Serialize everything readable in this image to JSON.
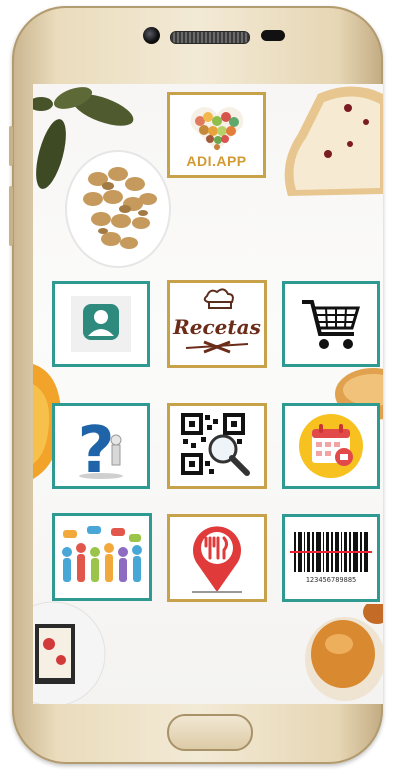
{
  "app": {
    "logo_text": "ADI.APP"
  },
  "tiles": [
    {
      "icon": "user-profile-icon"
    },
    {
      "icon": "recipes-logo-icon",
      "label": "Recetas"
    },
    {
      "icon": "shopping-cart-icon"
    },
    {
      "icon": "question-help-icon",
      "label": "?"
    },
    {
      "icon": "qr-search-icon"
    },
    {
      "icon": "calendar-icon"
    },
    {
      "icon": "community-people-icon"
    },
    {
      "icon": "restaurant-location-icon"
    },
    {
      "icon": "barcode-scanner-icon",
      "label": "123456789885"
    }
  ],
  "colors": {
    "teal_border": "#2e9a92",
    "gold_border": "#c8a24a",
    "phone_gold": "#e6d6b4"
  }
}
